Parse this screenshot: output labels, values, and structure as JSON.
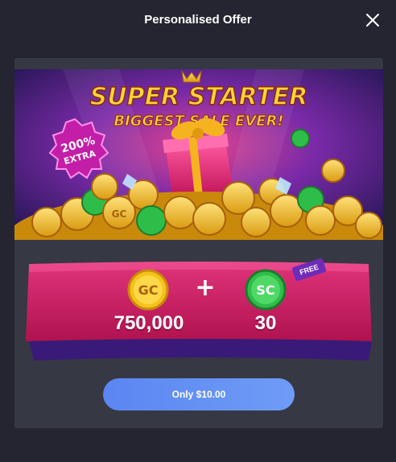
{
  "header": {
    "title": "Personalised Offer",
    "close_icon": "close-icon"
  },
  "banner": {
    "headline": "SUPER STARTER",
    "subline": "BIGGEST SALE EVER!",
    "badge_line1": "200%",
    "badge_line2": "EXTRA",
    "coin_text": "GC"
  },
  "rewards": {
    "gc_coin_text": "GC",
    "gc_amount": "750,000",
    "plus": "+",
    "sc_coin_text": "SC",
    "sc_amount": "30",
    "free_tag": "FREE"
  },
  "cta": {
    "label": "Only $10.00"
  },
  "colors": {
    "background": "#242530",
    "card": "#363844",
    "ribbon": "#c91a5f",
    "cta": "#5b86f2",
    "gold": "#f5c21a",
    "green": "#2fbd4a"
  }
}
